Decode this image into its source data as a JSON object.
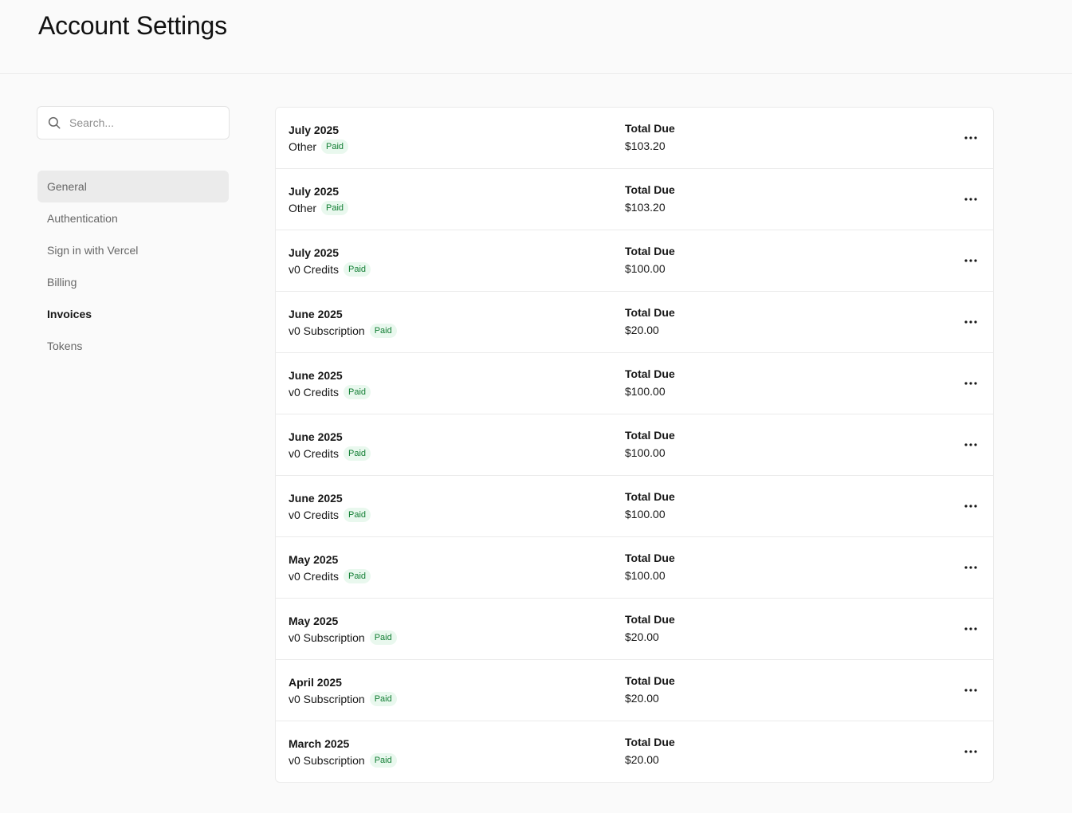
{
  "header": {
    "title": "Account Settings"
  },
  "search": {
    "placeholder": "Search..."
  },
  "sidebar": {
    "items": [
      {
        "label": "General"
      },
      {
        "label": "Authentication"
      },
      {
        "label": "Sign in with Vercel"
      },
      {
        "label": "Billing"
      },
      {
        "label": "Invoices"
      },
      {
        "label": "Tokens"
      }
    ]
  },
  "invoices": {
    "total_label": "Total Due",
    "rows": [
      {
        "date": "July 2025",
        "type": "Other",
        "status": "Paid",
        "amount": "$103.20"
      },
      {
        "date": "July 2025",
        "type": "Other",
        "status": "Paid",
        "amount": "$103.20"
      },
      {
        "date": "July 2025",
        "type": "v0 Credits",
        "status": "Paid",
        "amount": "$100.00"
      },
      {
        "date": "June 2025",
        "type": "v0 Subscription",
        "status": "Paid",
        "amount": "$20.00"
      },
      {
        "date": "June 2025",
        "type": "v0 Credits",
        "status": "Paid",
        "amount": "$100.00"
      },
      {
        "date": "June 2025",
        "type": "v0 Credits",
        "status": "Paid",
        "amount": "$100.00"
      },
      {
        "date": "June 2025",
        "type": "v0 Credits",
        "status": "Paid",
        "amount": "$100.00"
      },
      {
        "date": "May 2025",
        "type": "v0 Credits",
        "status": "Paid",
        "amount": "$100.00"
      },
      {
        "date": "May 2025",
        "type": "v0 Subscription",
        "status": "Paid",
        "amount": "$20.00"
      },
      {
        "date": "April 2025",
        "type": "v0 Subscription",
        "status": "Paid",
        "amount": "$20.00"
      },
      {
        "date": "March 2025",
        "type": "v0 Subscription",
        "status": "Paid",
        "amount": "$20.00"
      }
    ]
  },
  "colors": {
    "page_bg": "#fafafa",
    "paid_text": "#107d32",
    "paid_bg": "#e9f8ee",
    "active_nav_bg": "#ebebeb"
  },
  "icons": {
    "search": "search-icon",
    "more": "more-horizontal-icon"
  }
}
